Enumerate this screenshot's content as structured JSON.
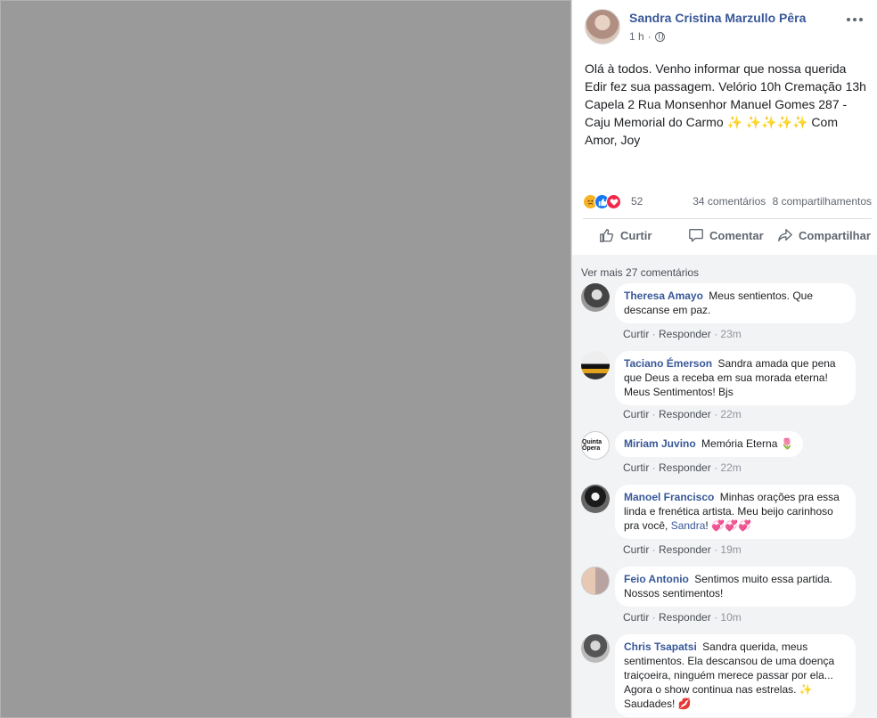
{
  "photo": {
    "alt": "Foto"
  },
  "post": {
    "author": "Sandra Cristina Marzullo Pêra",
    "time": "1 h",
    "text": "Olá à todos. Venho informar que nossa querida Edir fez sua passagem. Velório 10h Cremação 13h Capela 2 Rua Monsenhor Manuel Gomes 287 - Caju Memorial do Carmo ✨ ✨✨✨✨ Com Amor, Joy",
    "reactions_count": "52",
    "comments_count": "34 comentários",
    "shares_count": "8 compartilhamentos",
    "reaction_types": [
      "sad",
      "like",
      "love"
    ]
  },
  "actions": {
    "like": "Curtir",
    "comment": "Comentar",
    "share": "Compartilhar"
  },
  "comments_section": {
    "view_more": "Ver mais 27 comentários",
    "like_label": "Curtir",
    "reply_label": "Responder",
    "comments": [
      {
        "name": "Theresa Amayo",
        "text": "Meus sentientos. Que descanse em paz.",
        "time": "23m"
      },
      {
        "name": "Taciano Émerson",
        "text": "Sandra amada que pena que Deus a receba em sua morada eterna! Meus Sentimentos! Bjs",
        "time": "22m"
      },
      {
        "name": "Miriam Juvino",
        "text": "Memória Eterna 🌷",
        "time": "22m",
        "avatar_text": "Quinta Ópera"
      },
      {
        "name": "Manoel Francisco",
        "text": "Minhas orações pra essa linda e frenética artista. Meu beijo carinhoso pra você,",
        "mention": "Sandra",
        "text_after": "! 💞💞💞",
        "time": "19m"
      },
      {
        "name": "Feio Antonio",
        "text": "Sentimos muito essa partida. Nossos sentimentos!",
        "time": "10m"
      },
      {
        "name": "Chris Tsapatsi",
        "text": "Sandra querida, meus sentimentos. Ela descansou de uma doença traiçoeira, ninguém merece passar por ela... Agora o show continua nas estrelas. ✨ Saudades! 💋"
      }
    ]
  },
  "colors": {
    "link": "#385898",
    "muted": "#616770",
    "comments_bg": "#f2f3f5",
    "like_blue": "#1877f2",
    "love_red": "#f0284a",
    "sad_yellow": "#f7b125"
  }
}
